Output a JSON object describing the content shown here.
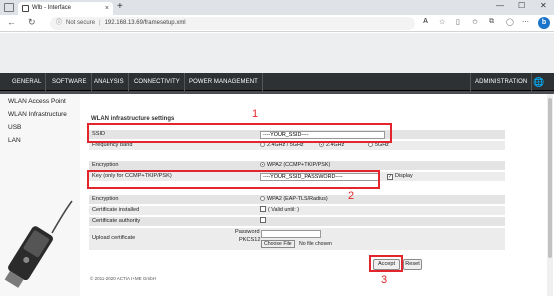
{
  "browser": {
    "tab_title": "Wlb - Interface",
    "tab_close": "×",
    "new_tab": "+",
    "win_min": "—",
    "win_max": "☐",
    "win_close": "✕",
    "back": "←",
    "reload": "↻",
    "security_label": "Not secure",
    "url": "192.168.13.69/framesetup.xml",
    "read_aloud": "A",
    "bing": "b"
  },
  "menu": {
    "items": [
      "GENERAL",
      "SOFTWARE",
      "ANALYSIS",
      "CONNECTIVITY",
      "POWER MANAGEMENT"
    ],
    "right": "ADMINISTRATION"
  },
  "sidebar": {
    "items": [
      "WLAN Access Point",
      "WLAN Infrastructure",
      "USB",
      "LAN"
    ]
  },
  "form": {
    "section_title": "WLAN infrastructure settings",
    "ssid_label": "SSID",
    "ssid_value": "----YOUR_SSID----",
    "freq_label": "Frequency band",
    "freq_options": [
      "2.4GHz / 5GHz",
      "2.4GHz",
      "5GHz"
    ],
    "freq_selected": "2.4GHz",
    "enc1_label": "Encryption",
    "enc1_value": "WPA2 (CCMP+TKIP/PSK)",
    "key_label": "Key (only for CCMP+TKIP/PSK)",
    "key_value": "----YOUR_SSID_PASSWORD----",
    "display_label": "Display",
    "enc2_label": "Encryption",
    "enc2_value": "WPA2 (EAP-TLS/Radius)",
    "cert_installed_label": "Certificate installed",
    "cert_installed_value": "( Valid until: )",
    "cert_authority_label": "Certificate authority",
    "upload_label": "Upload certificate",
    "password_label": "Password",
    "pkcs_label": "PKCS12",
    "choose_file": "Choose File",
    "no_file": "No file chosen",
    "accept": "Accept",
    "reset": "Reset",
    "copyright": "© 2011-2020 ACTIA I+ME GmbH"
  },
  "annotations": [
    "1",
    "2",
    "3"
  ],
  "colors": {
    "menubar": "#2e3133",
    "annotation_red": "#e3262b"
  }
}
